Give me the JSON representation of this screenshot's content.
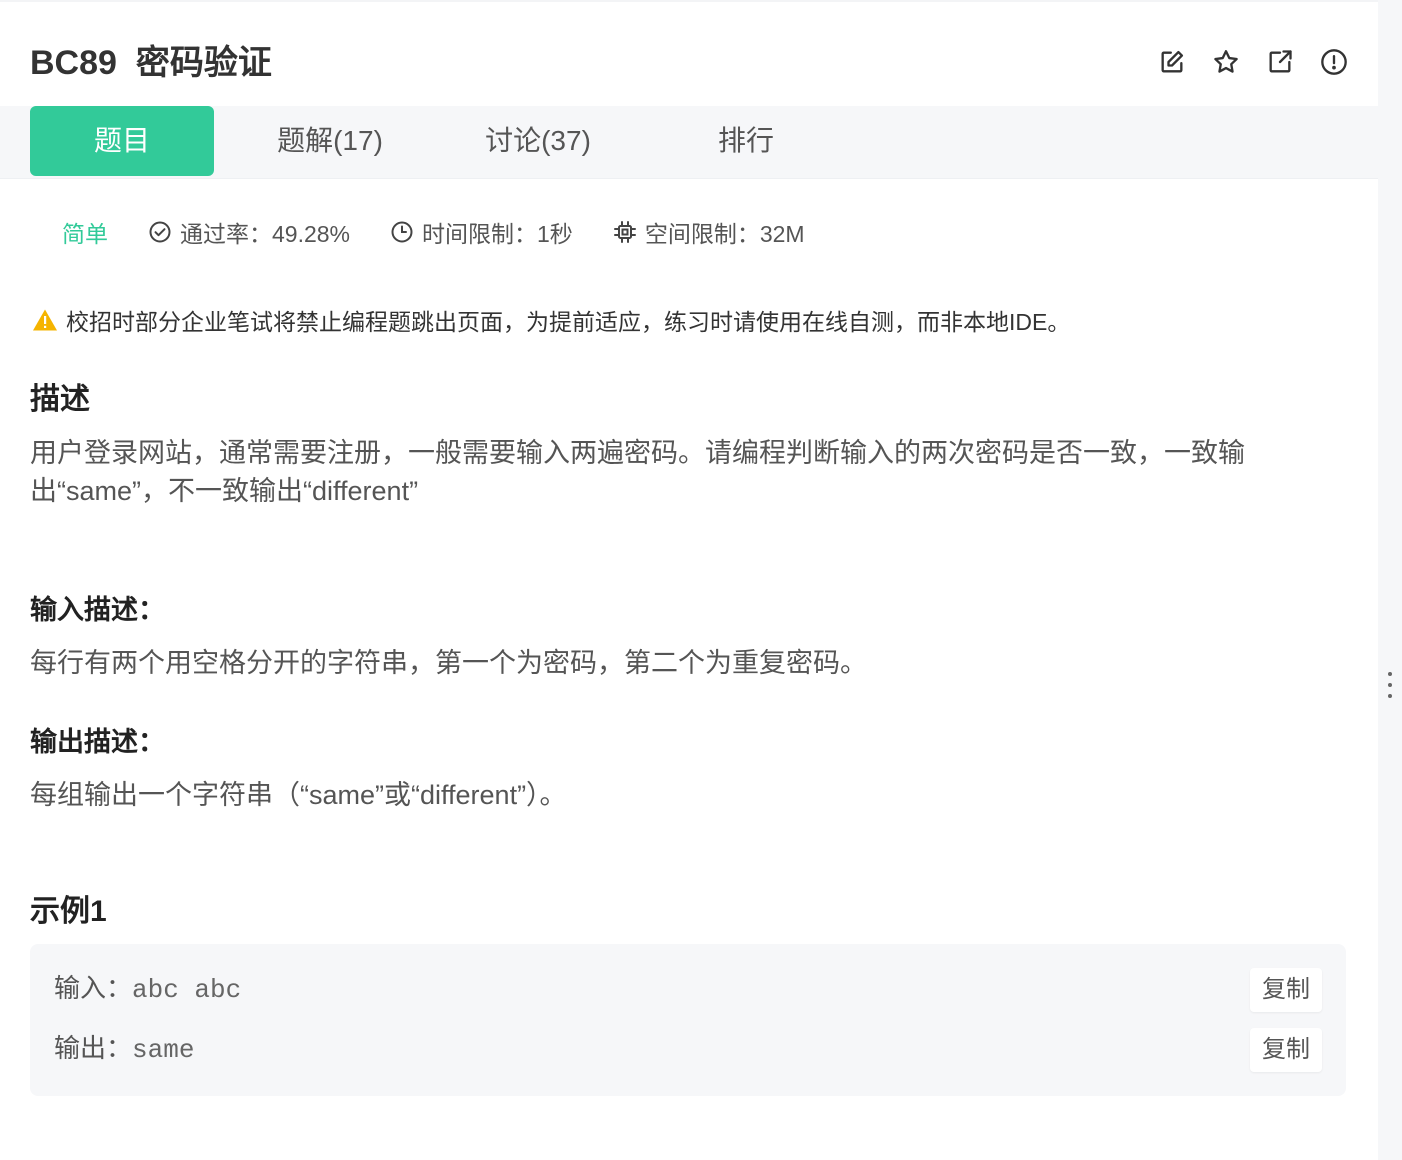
{
  "header": {
    "title": "BC89  密码验证",
    "icons": [
      "edit-icon",
      "star-icon",
      "external-link-icon",
      "alert-circle-icon"
    ]
  },
  "tabs": [
    {
      "label": "题目",
      "active": true
    },
    {
      "label": "题解(17)",
      "active": false
    },
    {
      "label": "讨论(37)",
      "active": false
    },
    {
      "label": "排行",
      "active": false
    }
  ],
  "meta": {
    "difficulty": "简单",
    "pass_rate": "通过率：49.28%",
    "time_limit": "时间限制：1秒",
    "space_limit": "空间限制：32M"
  },
  "notice": "校招时部分企业笔试将禁止编程题跳出页面，为提前适应，练习时请使用在线自测，而非本地IDE。",
  "description": {
    "heading": "描述",
    "text": "用户登录网站，通常需要注册，一般需要输入两遍密码。请编程判断输入的两次密码是否一致，一致输出“same”，不一致输出“different”"
  },
  "input_desc": {
    "heading": "输入描述：",
    "text": "每行有两个用空格分开的字符串，第一个为密码，第二个为重复密码。"
  },
  "output_desc": {
    "heading": "输出描述：",
    "text": "每组输出一个字符串（“same”或“different”）。"
  },
  "example": {
    "heading": "示例1",
    "input_label": "输入：",
    "input_value": "abc abc",
    "output_label": "输出：",
    "output_value": "same",
    "copy_label": "复制"
  },
  "colors": {
    "accent": "#32ca99",
    "warning": "#f5b400"
  }
}
